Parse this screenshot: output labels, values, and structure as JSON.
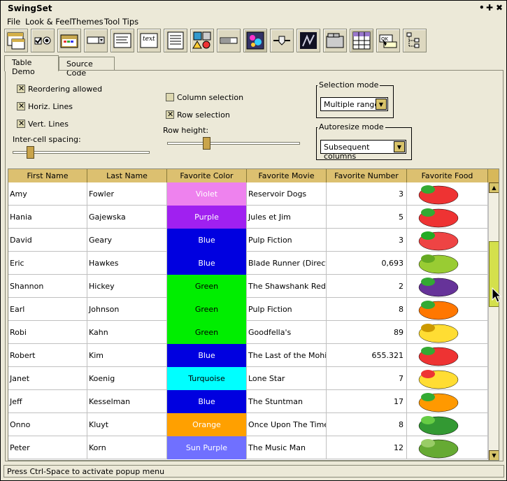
{
  "window": {
    "title": "SwingSet",
    "controls": [
      "•",
      "✚",
      "✖"
    ]
  },
  "menus": [
    {
      "label": "File",
      "accel": "F"
    },
    {
      "label": "Look & Feel",
      "accel": "L"
    },
    {
      "label": "Themes",
      "accel": "T"
    },
    {
      "label": "Tool Tips",
      "accel": "T"
    }
  ],
  "toolbar": {
    "buttons": [
      "internal-frame-icon",
      "checkbox-radio-icon",
      "file-chooser-icon",
      "combobox-icon",
      "text-field-icon",
      "label-icon",
      "list-icon",
      "option-pane-icon",
      "progress-bar-icon",
      "scroll-pane-icon",
      "slider-icon",
      "split-pane-icon",
      "tabbed-pane-icon",
      "table-icon",
      "tooltip-icon",
      "tree-icon"
    ]
  },
  "tabs": [
    "Table Demo",
    "Source Code"
  ],
  "options": {
    "reordering": "Reordering allowed",
    "horiz_lines": "Horiz. Lines",
    "vert_lines": "Vert. Lines",
    "intercell_label": "Inter-cell spacing:",
    "column_selection": "Column selection",
    "row_selection": "Row selection",
    "row_height_label": "Row height:",
    "selection_mode_title": "Selection mode",
    "selection_mode_value": "Multiple ranges",
    "autoresize_title": "Autoresize mode",
    "autoresize_value": "Subsequent columns"
  },
  "table": {
    "headers": [
      "First Name",
      "Last Name",
      "Favorite Color",
      "Favorite Movie",
      "Favorite Number",
      "Favorite Food"
    ],
    "rows": [
      {
        "first": "Amy",
        "last": "Fowler",
        "color": "Violet",
        "bg": "#ee82ee",
        "fg": "#ffffff",
        "movie": "Reservoir Dogs",
        "number": "3",
        "food": "strawberry"
      },
      {
        "first": "Hania",
        "last": "Gajewska",
        "color": "Purple",
        "bg": "#a020f0",
        "fg": "#ffffff",
        "movie": "Jules et Jim",
        "number": "5",
        "food": "strawberry"
      },
      {
        "first": "David",
        "last": "Geary",
        "color": "Blue",
        "bg": "#0000e0",
        "fg": "#ffffff",
        "movie": "Pulp Fiction",
        "number": "3",
        "food": "watermelon"
      },
      {
        "first": "Eric",
        "last": "Hawkes",
        "color": "Blue",
        "bg": "#0000e0",
        "fg": "#ffffff",
        "movie": "Blade Runner (Direct...",
        "number": "0,693",
        "food": "peas"
      },
      {
        "first": "Shannon",
        "last": "Hickey",
        "color": "Green",
        "bg": "#00ee00",
        "fg": "#000000",
        "movie": "The Shawshank Red...",
        "number": "2",
        "food": "grapes"
      },
      {
        "first": "Earl",
        "last": "Johnson",
        "color": "Green",
        "bg": "#00ee00",
        "fg": "#000000",
        "movie": "Pulp Fiction",
        "number": "8",
        "food": "carrot"
      },
      {
        "first": "Robi",
        "last": "Kahn",
        "color": "Green",
        "bg": "#00ee00",
        "fg": "#000000",
        "movie": "Goodfella's",
        "number": "89",
        "food": "banana"
      },
      {
        "first": "Robert",
        "last": "Kim",
        "color": "Blue",
        "bg": "#0000e0",
        "fg": "#ffffff",
        "movie": "The Last of the Mohi...",
        "number": "655.321",
        "food": "strawberry"
      },
      {
        "first": "Janet",
        "last": "Koenig",
        "color": "Turquoise",
        "bg": "#00ffff",
        "fg": "#000000",
        "movie": "Lone Star",
        "number": "7",
        "food": "banana-split"
      },
      {
        "first": "Jeff",
        "last": "Kesselman",
        "color": "Blue",
        "bg": "#0000e0",
        "fg": "#ffffff",
        "movie": "The Stuntman",
        "number": "17",
        "food": "orange"
      },
      {
        "first": "Onno",
        "last": "Kluyt",
        "color": "Orange",
        "bg": "#ffa000",
        "fg": "#ffffff",
        "movie": "Once Upon The Time...",
        "number": "8",
        "food": "broccoli"
      },
      {
        "first": "Peter",
        "last": "Korn",
        "color": "Sun Purple",
        "bg": "#7070ff",
        "fg": "#ffffff",
        "movie": "The Music Man",
        "number": "12",
        "food": "asparagus"
      }
    ]
  },
  "status": "Press Ctrl-Space to activate popup menu"
}
